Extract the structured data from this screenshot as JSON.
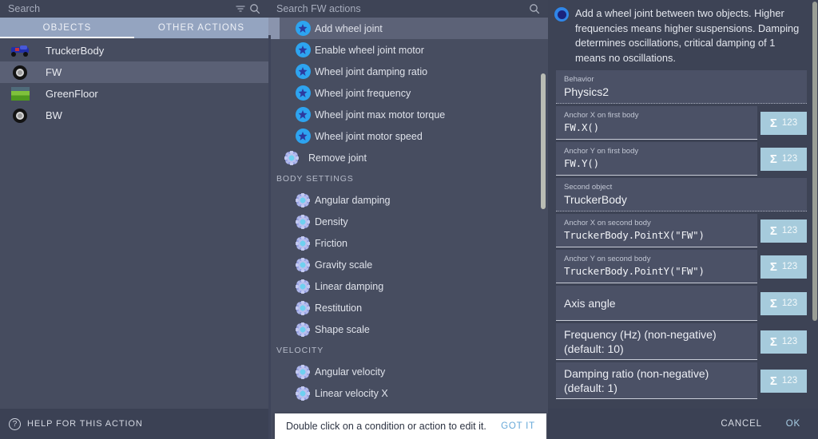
{
  "left_panel": {
    "search": {
      "placeholder": "Search",
      "filter_icon": "filter-icon",
      "search_icon": "search-icon"
    },
    "tabs": [
      {
        "label": "OBJECTS",
        "active": true
      },
      {
        "label": "OTHER ACTIONS",
        "active": false
      }
    ],
    "objects": [
      {
        "name": "TruckerBody",
        "icon": "truck-sprite-icon",
        "selected": false
      },
      {
        "name": "FW",
        "icon": "tire-sprite-icon",
        "selected": true
      },
      {
        "name": "GreenFloor",
        "icon": "landscape-sprite-icon",
        "selected": false
      },
      {
        "name": "BW",
        "icon": "tire-sprite-icon",
        "selected": false
      }
    ],
    "help_label": "HELP FOR THIS ACTION",
    "help_icon": "question-mark-icon"
  },
  "middle_panel": {
    "search": {
      "placeholder": "Search FW actions",
      "search_icon": "search-icon"
    },
    "items": [
      {
        "label": "Add wheel joint",
        "icon": "joint-icon",
        "selected": true,
        "indent": true
      },
      {
        "label": "Enable wheel joint motor",
        "icon": "joint-icon",
        "selected": false,
        "indent": true
      },
      {
        "label": "Wheel joint damping ratio",
        "icon": "joint-icon",
        "selected": false,
        "indent": true
      },
      {
        "label": "Wheel joint frequency",
        "icon": "joint-icon",
        "selected": false,
        "indent": true
      },
      {
        "label": "Wheel joint max motor torque",
        "icon": "joint-icon",
        "selected": false,
        "indent": true
      },
      {
        "label": "Wheel joint motor speed",
        "icon": "joint-icon",
        "selected": false,
        "indent": true
      },
      {
        "label": "Remove joint",
        "icon": "gear-icon",
        "selected": false,
        "indent": false
      }
    ],
    "section_body_settings": "BODY SETTINGS",
    "body_settings": [
      {
        "label": "Angular damping",
        "icon": "gear-icon"
      },
      {
        "label": "Density",
        "icon": "gear-icon"
      },
      {
        "label": "Friction",
        "icon": "gear-icon"
      },
      {
        "label": "Gravity scale",
        "icon": "gear-icon"
      },
      {
        "label": "Linear damping",
        "icon": "gear-icon"
      },
      {
        "label": "Restitution",
        "icon": "gear-icon"
      },
      {
        "label": "Shape scale",
        "icon": "gear-icon"
      }
    ],
    "section_velocity": "VELOCITY",
    "velocity": [
      {
        "label": "Angular velocity",
        "icon": "gear-icon"
      },
      {
        "label": "Linear velocity X",
        "icon": "gear-icon"
      }
    ]
  },
  "right_panel": {
    "description": "Add a wheel joint between two objects. Higher frequencies means higher suspensions. Damping determines oscillations, critical damping of 1 means no oscillations.",
    "description_icon": "action-bullet-icon",
    "fields": [
      {
        "label": "Behavior",
        "value": "Physics2",
        "mono": false,
        "sigma": false,
        "underline": "dotted"
      },
      {
        "label": "Anchor X on first body",
        "value": "FW.X()",
        "mono": true,
        "sigma": true,
        "underline": "solid"
      },
      {
        "label": "Anchor Y on first body",
        "value": "FW.Y()",
        "mono": true,
        "sigma": true,
        "underline": "solid"
      },
      {
        "label": "Second object",
        "value": "TruckerBody",
        "mono": false,
        "sigma": false,
        "underline": "dotted"
      },
      {
        "label": "Anchor X on second body",
        "value": "TruckerBody.PointX(\"FW\")",
        "mono": true,
        "sigma": true,
        "underline": "solid"
      },
      {
        "label": "Anchor Y on second body",
        "value": "TruckerBody.PointY(\"FW\")",
        "mono": true,
        "sigma": true,
        "underline": "solid"
      },
      {
        "label": "",
        "value": "Axis angle",
        "mono": false,
        "sigma": true,
        "underline": "solid",
        "placeholder_only": true
      },
      {
        "label": "",
        "value": "Frequency (Hz) (non-negative) (default: 10)",
        "mono": false,
        "sigma": true,
        "underline": "solid",
        "placeholder_only": true
      },
      {
        "label": "",
        "value": "Damping ratio (non-negative) (default: 1)",
        "mono": false,
        "sigma": true,
        "underline": "solid",
        "placeholder_only": true
      }
    ],
    "sigma_button": {
      "symbol": "Σ",
      "number": "123"
    },
    "cancel_label": "CANCEL",
    "ok_label": "OK"
  },
  "tooltip": {
    "text": "Double click on a condition or action to edit it.",
    "action_label": "GOT IT"
  },
  "colors": {
    "window_bg": "#3d4355",
    "panel_bg": "#474d60",
    "tab_bg": "#94a4c0",
    "selection": "#5a6075",
    "sigma_btn": "#a6cbdc",
    "ok_link": "#a9cfe6",
    "joint_icon": "#2da4f0"
  }
}
